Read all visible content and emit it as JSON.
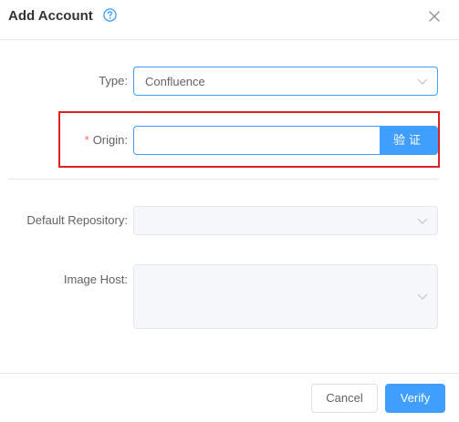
{
  "dialog": {
    "title": "Add Account",
    "help_icon": "question-circle-icon",
    "close_icon": "close-icon"
  },
  "form": {
    "type": {
      "label": "Type",
      "value": "Confluence"
    },
    "origin": {
      "required_mark": "*",
      "label": "Origin",
      "value": "",
      "button_label": "验证"
    },
    "default_repository": {
      "label": "Default Repository",
      "value": ""
    },
    "image_host": {
      "label": "Image Host",
      "value": ""
    },
    "label_suffix": ":"
  },
  "footer": {
    "cancel_label": "Cancel",
    "verify_label": "Verify"
  },
  "colors": {
    "primary": "#409eff",
    "highlight": "#e02020",
    "required": "#f56c6c"
  }
}
